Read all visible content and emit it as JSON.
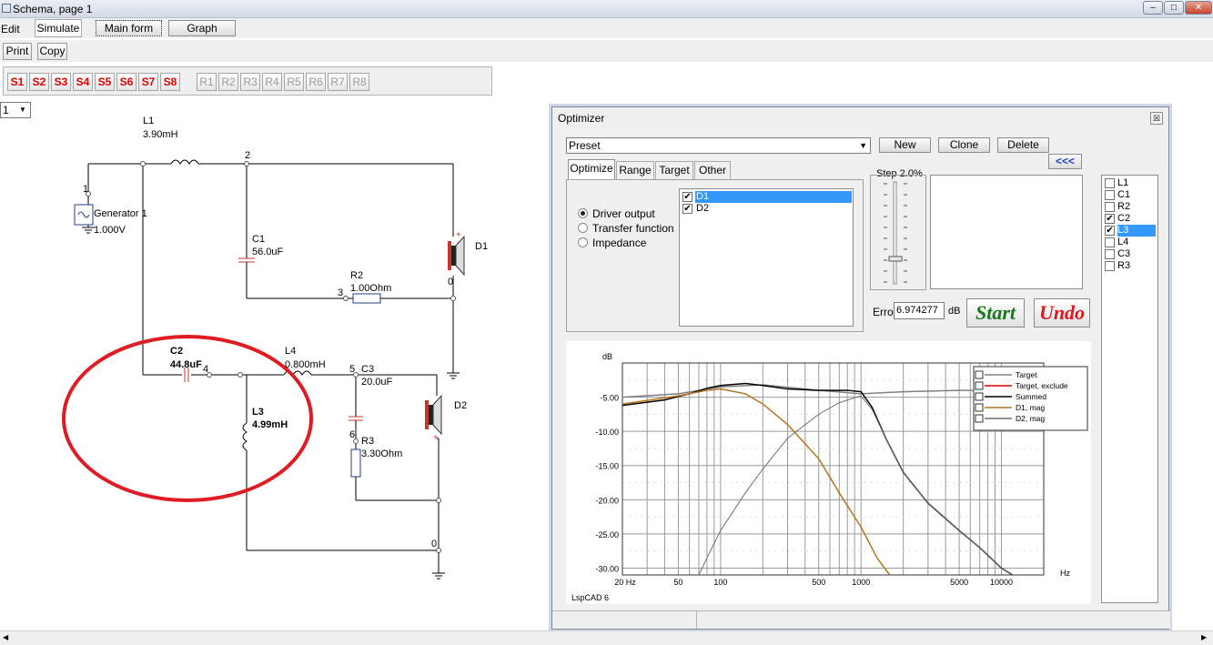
{
  "window": {
    "title": "Schema, page 1"
  },
  "menu": {
    "edit": "Edit",
    "simulate": "Simulate",
    "main_form": "Main form",
    "graph": "Graph"
  },
  "toolbar": {
    "print": "Print",
    "copy": "Copy"
  },
  "s_buttons": [
    "S1",
    "S2",
    "S3",
    "S4",
    "S5",
    "S6",
    "S7",
    "S8"
  ],
  "r_buttons": [
    "R1",
    "R2",
    "R3",
    "R4",
    "R5",
    "R6",
    "R7",
    "R8"
  ],
  "page_select": "1",
  "schematic": {
    "L1": {
      "name": "L1",
      "value": "3.90mH"
    },
    "generator": {
      "name": "Generator 1",
      "value": "1.000V"
    },
    "C1": {
      "name": "C1",
      "value": "56.0uF"
    },
    "R2": {
      "name": "R2",
      "value": "1.00Ohm"
    },
    "D1": "D1",
    "C2": {
      "name": "C2",
      "value": "44.8uF"
    },
    "L4": {
      "name": "L4",
      "value": "0.800mH"
    },
    "C3": {
      "name": "C3",
      "value": "20.0uF"
    },
    "L3": {
      "name": "L3",
      "value": "4.99mH"
    },
    "R3": {
      "name": "R3",
      "value": "3.30Ohm"
    },
    "D2": "D2",
    "nodes": [
      "1",
      "2",
      "3",
      "0",
      "4",
      "5",
      "6",
      "0"
    ],
    "polarity": "+",
    "highlight_color": "#e01b24"
  },
  "optimizer": {
    "title": "Optimizer",
    "preset": "Preset",
    "new": "New",
    "clone": "Clone",
    "delete": "Delete",
    "collapse": "<<<",
    "tabs": [
      "Optimize",
      "Range",
      "Target",
      "Other"
    ],
    "modes": [
      "Driver output",
      "Transfer function",
      "Impedance"
    ],
    "drivers": [
      "D1",
      "D2"
    ],
    "step_label": "Step 2.0%",
    "error_label": "Error",
    "error_value": "6.974277",
    "error_unit": "dB",
    "start": "Start",
    "undo": "Undo",
    "components": [
      {
        "name": "L1",
        "checked": false
      },
      {
        "name": "C1",
        "checked": false
      },
      {
        "name": "R2",
        "checked": false
      },
      {
        "name": "C2",
        "checked": true
      },
      {
        "name": "L3",
        "checked": true
      },
      {
        "name": "L4",
        "checked": false
      },
      {
        "name": "C3",
        "checked": false
      },
      {
        "name": "R3",
        "checked": false
      }
    ]
  },
  "chart_data": {
    "type": "line",
    "xscale": "log",
    "xlim": [
      20,
      20000
    ],
    "ylim": [
      -31,
      0
    ],
    "ylabel": "dB",
    "xlabel": "Hz",
    "y_ticks": [
      "-5.00",
      "-10.00",
      "-15.00",
      "-20.00",
      "-25.00",
      "-30.00"
    ],
    "x_ticks": [
      "20 Hz",
      "50",
      "100",
      "500",
      "1000",
      "5000",
      "10000"
    ],
    "watermark": "LspCAD 6",
    "grid": true,
    "legend_position": "top-right",
    "legend": [
      "Target",
      "Target, exclude",
      "Summed",
      "D1, mag",
      "D2, mag"
    ],
    "series": [
      {
        "name": "Target",
        "color": "#808080",
        "x": [
          20,
          50,
          100,
          200,
          500,
          1000,
          2000,
          5000,
          10000,
          20000
        ],
        "y": [
          -5.0,
          -4.5,
          -3.5,
          -3.2,
          -4.0,
          -4.5,
          -4.2,
          -4.0,
          -4.0,
          -3.9
        ]
      },
      {
        "name": "Summed",
        "color": "#000000",
        "x": [
          20,
          40,
          60,
          80,
          100,
          150,
          200,
          300,
          500,
          800,
          1000,
          1200,
          1500,
          2000,
          3000,
          5000,
          7000,
          10000,
          12000
        ],
        "y": [
          -6.2,
          -5.4,
          -4.5,
          -3.7,
          -3.3,
          -3.0,
          -3.3,
          -3.8,
          -4.0,
          -4.0,
          -4.2,
          -6.5,
          -11.0,
          -16.0,
          -20.5,
          -24.5,
          -27.0,
          -30.0,
          -32.0
        ]
      },
      {
        "name": "D1, mag",
        "color": "#b8741a",
        "x": [
          20,
          50,
          80,
          100,
          150,
          200,
          300,
          500,
          700,
          1000,
          1300,
          1600
        ],
        "y": [
          -6.0,
          -4.8,
          -4.0,
          -3.8,
          -4.5,
          -6.0,
          -9.0,
          -14.0,
          -19.0,
          -24.0,
          -28.5,
          -32.0
        ]
      },
      {
        "name": "D2, mag",
        "color": "#6e6e6e",
        "x": [
          70,
          80,
          100,
          150,
          200,
          300,
          500,
          700,
          1000,
          1200,
          1500,
          2000,
          3000,
          5000,
          7000,
          10000,
          12000
        ],
        "y": [
          -31.0,
          -28.5,
          -24.5,
          -19.0,
          -15.5,
          -11.0,
          -7.5,
          -5.8,
          -4.8,
          -6.8,
          -11.0,
          -16.0,
          -20.5,
          -24.5,
          -27.0,
          -30.0,
          -32.0
        ]
      }
    ]
  }
}
